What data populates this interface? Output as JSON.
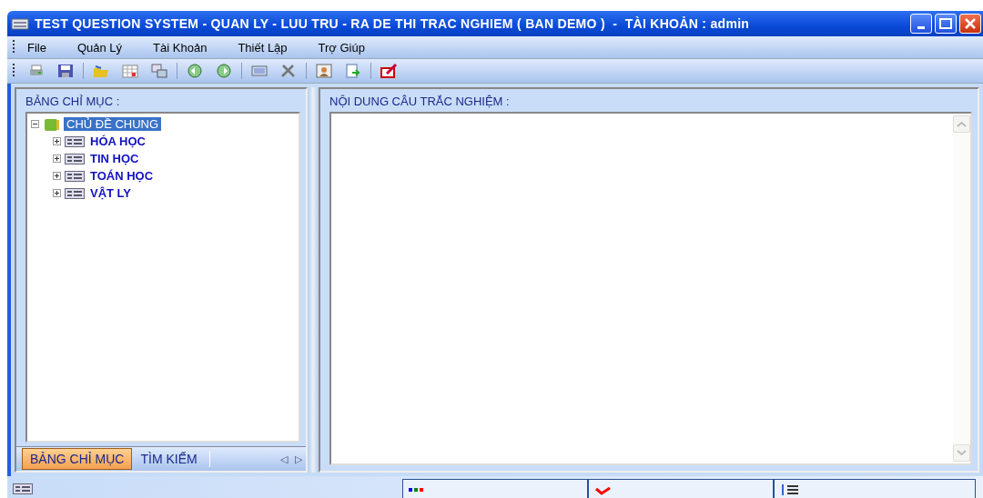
{
  "window": {
    "title": "TEST QUESTION SYSTEM - QUAN LY - LUU TRU - RA DE THI TRAC NGHIEM ( BAN DEMO )  -  TÀI KHOẢN : admin"
  },
  "menu": [
    "File",
    "Quản Lý",
    "Tài Khoản",
    "Thiết Lập",
    "Trợ Giúp"
  ],
  "left_panel": {
    "title": "BẢNG CHỈ MỤC :",
    "tree": [
      {
        "label": "CHỦ ĐỀ CHUNG",
        "expanded": true,
        "selected": true,
        "children": [
          {
            "label": "HÓA HỌC",
            "expanded": false,
            "selected": false
          },
          {
            "label": "TIN HỌC",
            "expanded": false,
            "selected": false
          },
          {
            "label": "TOÁN HỌC",
            "expanded": false,
            "selected": false
          },
          {
            "label": "VẬT LY",
            "expanded": false,
            "selected": false
          }
        ]
      }
    ],
    "tabs": [
      {
        "label": "BẢNG CHỈ MỤC",
        "selected": true
      },
      {
        "label": "TÌM KIẾM",
        "selected": false
      }
    ],
    "tab_scroll": [
      "◁",
      "▷"
    ]
  },
  "right_panel": {
    "title": "NỘI DUNG CÂU TRẮC NGHIỆM  :"
  }
}
